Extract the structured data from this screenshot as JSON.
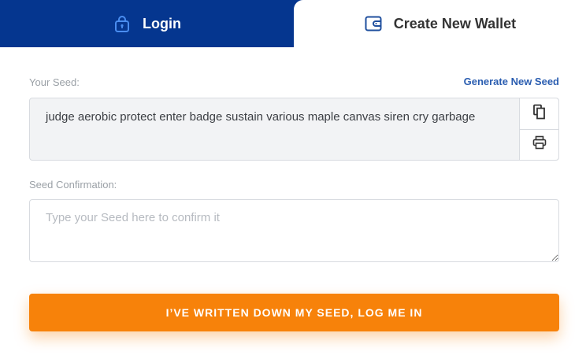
{
  "tabs": {
    "login": {
      "label": "Login",
      "icon": "lock-icon"
    },
    "create": {
      "label": "Create New Wallet",
      "icon": "wallet-icon"
    }
  },
  "seed": {
    "label": "Your Seed:",
    "generate_link": "Generate New Seed",
    "value": "judge aerobic protect enter badge sustain various maple canvas siren cry garbage",
    "copy_icon": "copy-icon",
    "print_icon": "printer-icon"
  },
  "confirmation": {
    "label": "Seed Confirmation:",
    "placeholder": "Type your Seed here to confirm it",
    "value": ""
  },
  "submit": {
    "label": "I’VE WRITTEN DOWN MY SEED, LOG ME IN"
  },
  "colors": {
    "brand_blue": "#05368f",
    "accent_orange": "#f7820a",
    "link_blue": "#2a5db0"
  }
}
